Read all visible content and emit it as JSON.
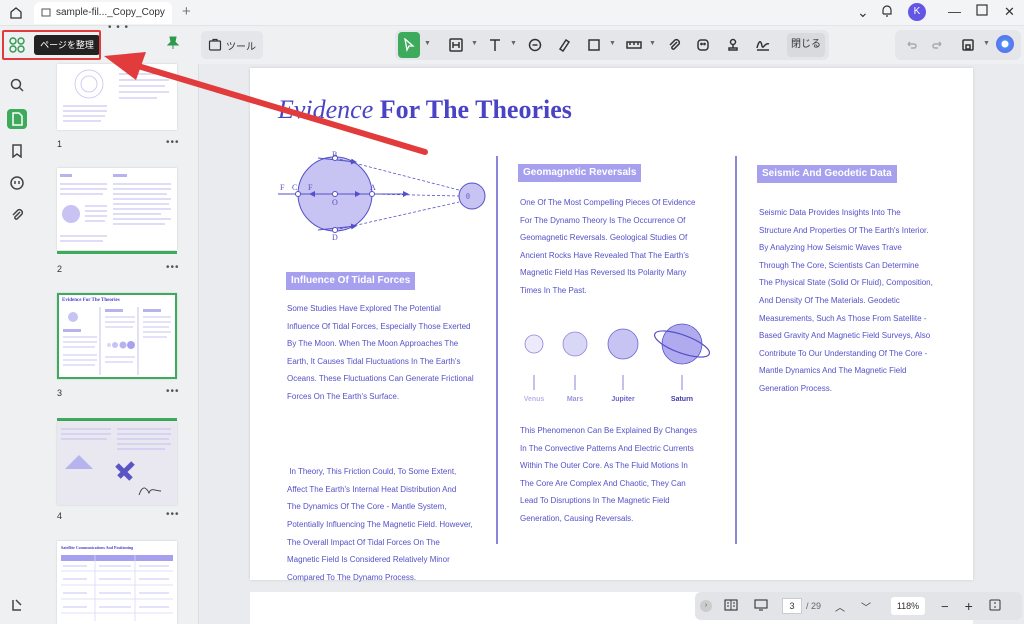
{
  "tab": {
    "title": "sample-fil..._Copy_Copy"
  },
  "toolbar": {
    "tools_label": "ツール",
    "close_label": "閉じる"
  },
  "tooltip": {
    "organize_pages": "ページを整理"
  },
  "thumbnails": [
    {
      "num": "1",
      "title": ""
    },
    {
      "num": "2",
      "title": ""
    },
    {
      "num": "3",
      "title": "Evidence For The Theories"
    },
    {
      "num": "4",
      "title": ""
    },
    {
      "num": "",
      "title": "Satellite Communications And Positioning"
    }
  ],
  "doc": {
    "title_italic": "Evidence",
    "title_rest": "For The Theories",
    "tidal": {
      "heading": "Influence Of Tidal Forces",
      "p1": [
        "Some Studies Have Explored The Potential",
        "Influence Of Tidal Forces, Especially Those Exerted",
        "By The Moon. When The Moon Approaches The",
        "Earth, It Causes Tidal Fluctuations In The Earth's",
        "Oceans. These Fluctuations Can Generate Frictional",
        "Forces On The Earth's Surface."
      ],
      "p2": [
        " In Theory, This Friction Could, To Some Extent,",
        "Affect The Earth's Internal Heat Distribution And",
        "The Dynamics Of The Core - Mantle System,",
        "Potentially Influencing The Magnetic Field. However,",
        "The Overall Impact Of Tidal Forces On The",
        "Magnetic Field Is Considered Relatively Minor",
        "Compared To The Dynamo Process."
      ]
    },
    "geomagnetic": {
      "heading": "Geomagnetic Reversals",
      "p1": [
        "One Of The Most Compelling Pieces Of Evidence",
        "For The Dynamo Theory Is The Occurrence Of",
        "Geomagnetic Reversals. Geological Studies Of",
        "Ancient Rocks Have Revealed That The Earth's",
        "Magnetic Field Has Reversed Its Polarity Many",
        "Times In The Past."
      ],
      "planets": [
        "Venus",
        "Mars",
        "Jupiter",
        "Saturn"
      ],
      "p2": [
        "This Phenomenon Can Be Explained By Changes",
        "In The Convective Patterns And Electric Currents",
        "Within The Outer Core. As The Fluid Motions In",
        "The Core Are Complex And Chaotic, They Can",
        "Lead To Disruptions In The Magnetic Field",
        "Generation, Causing Reversals."
      ]
    },
    "seismic": {
      "heading": "Seismic And Geodetic Data",
      "p1": [
        "Seismic Data Provides Insights Into The",
        "Structure And Properties Of The Earth's Interior.",
        "By Analyzing How Seismic Waves Trave",
        "Through The Core, Scientists Can Determine",
        "The Physical State (Solid Or Fluid), Composition,",
        "And Density Of The Materials. Geodetic",
        "Measurements, Such As Those From Satellite -",
        "Based Gravity And Magnetic Field Surveys, Also",
        "Contribute To Our Understanding Of The Core -",
        "Mantle Dynamics And The Magnetic Field",
        "Generation Process."
      ]
    },
    "diagram_labels": {
      "F1": "F",
      "C": "C",
      "F2": "F",
      "B": "B",
      "O": "O",
      "A": "A",
      "D": "D",
      "sat": "θ"
    }
  },
  "footer": {
    "page_current": "3",
    "page_total": "/ 29",
    "zoom": "118%"
  },
  "rail_user": "K",
  "colors": {
    "accent": "#3daa5c",
    "doc_text": "#5550c8",
    "heading_bg": "#a6a0ef",
    "annotation": "#e23b3b"
  }
}
